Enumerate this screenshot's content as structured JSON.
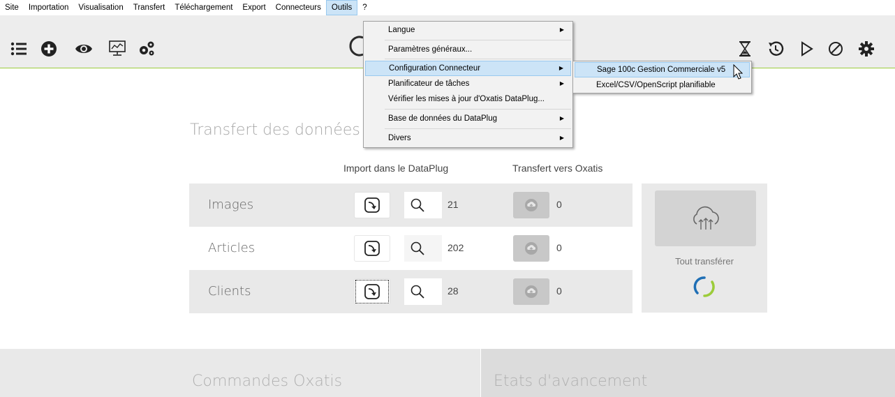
{
  "menubar": {
    "items": [
      "Site",
      "Importation",
      "Visualisation",
      "Transfert",
      "Téléchargement",
      "Export",
      "Connecteurs",
      "Outils",
      "?"
    ]
  },
  "toolbar": {
    "left_icons": [
      "list-icon",
      "plus-circle-icon",
      "eye-icon",
      "monitor-chart-icon",
      "gears-icon"
    ],
    "right_icons": [
      "hourglass-icon",
      "history-icon",
      "play-icon",
      "cancel-icon",
      "gear-icon"
    ]
  },
  "dropdown": {
    "items": [
      {
        "label": "Langue",
        "submenu": true
      },
      {
        "label": "Paramètres généraux...",
        "submenu": false
      },
      {
        "label": "Configuration Connecteur",
        "submenu": true,
        "highlighted": true
      },
      {
        "label": "Planificateur de tâches",
        "submenu": true
      },
      {
        "label": "Vérifier les mises à jour d'Oxatis DataPlug...",
        "submenu": false
      },
      {
        "label": "Base de données du DataPlug",
        "submenu": true
      },
      {
        "label": "Divers",
        "submenu": true
      }
    ]
  },
  "submenu": {
    "items": [
      {
        "label": "Sage 100c Gestion Commerciale v5",
        "highlighted": true
      },
      {
        "label": "Excel/CSV/OpenScript planifiable"
      }
    ]
  },
  "main": {
    "title": "Transfert des données",
    "col_import": "Import dans le DataPlug",
    "col_transfer": "Transfert vers Oxatis",
    "rows": [
      {
        "label": "Images",
        "count": "21",
        "transfer_count": "0"
      },
      {
        "label": "Articles",
        "count": "202",
        "transfer_count": "0"
      },
      {
        "label": "Clients",
        "count": "28",
        "transfer_count": "0"
      }
    ],
    "transfer_all": "Tout transférer"
  },
  "bottom": {
    "left": "Commandes Oxatis",
    "right": "Etats d'avancement"
  },
  "colors": {
    "accent_green": "#9ccc3a",
    "menu_highlight": "#cce4f7",
    "spinner_blue": "#1f6fb5"
  }
}
